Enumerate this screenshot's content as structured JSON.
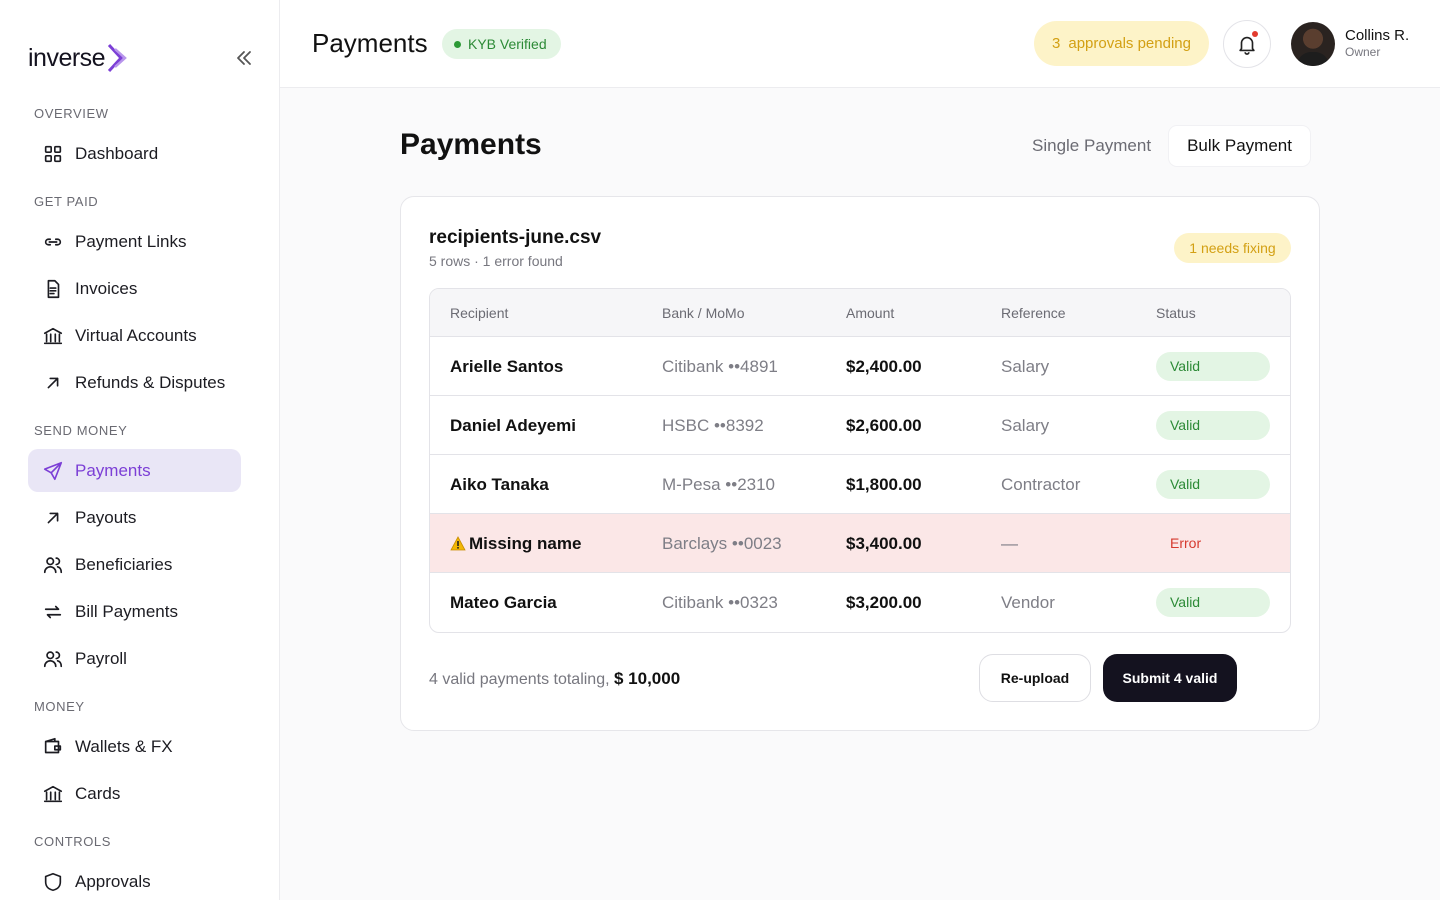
{
  "brand": {
    "logo_text": "inverse",
    "accent": "#7c3fd6"
  },
  "sidebar": {
    "sections": [
      {
        "title": "OVERVIEW",
        "items": [
          {
            "label": "Dashboard",
            "icon": "grid-icon"
          }
        ]
      },
      {
        "title": "GET PAID",
        "items": [
          {
            "label": "Payment Links",
            "icon": "link-icon"
          },
          {
            "label": "Invoices",
            "icon": "document-icon"
          },
          {
            "label": "Virtual Accounts",
            "icon": "bank-icon"
          },
          {
            "label": "Refunds & Disputes",
            "icon": "arrow-up-right-icon"
          }
        ]
      },
      {
        "title": "SEND MONEY",
        "items": [
          {
            "label": "Payments",
            "icon": "send-icon",
            "active": true
          },
          {
            "label": "Payouts",
            "icon": "arrow-up-right-icon"
          },
          {
            "label": "Beneficiaries",
            "icon": "users-icon"
          },
          {
            "label": "Bill Payments",
            "icon": "transfer-icon"
          },
          {
            "label": "Payroll",
            "icon": "users-icon"
          }
        ]
      },
      {
        "title": "MONEY",
        "items": [
          {
            "label": "Wallets & FX",
            "icon": "wallet-icon"
          },
          {
            "label": "Cards",
            "icon": "bank-icon"
          }
        ]
      },
      {
        "title": "CONTROLS",
        "items": [
          {
            "label": "Approvals",
            "icon": "shield-icon"
          }
        ]
      }
    ]
  },
  "header": {
    "title": "Payments",
    "kyb_label": "KYB Verified",
    "approvals_count": "3",
    "approvals_label": "approvals pending",
    "user_name": "Collins R.",
    "user_role": "Owner"
  },
  "main": {
    "title": "Payments",
    "tabs": [
      {
        "label": "Single Payment",
        "active": false
      },
      {
        "label": "Bulk Payment",
        "active": true
      }
    ]
  },
  "upload": {
    "file_name": "recipients-june.csv",
    "meta": "5 rows · 1 error found",
    "fix_badge": "1 needs fixing",
    "columns": [
      "Recipient",
      "Bank / MoMo",
      "Amount",
      "Reference",
      "Status"
    ],
    "rows": [
      {
        "recipient": "Arielle Santos",
        "bank": "Citibank ••4891",
        "amount": "$2,400.00",
        "reference": "Salary",
        "status": "Valid",
        "error": false
      },
      {
        "recipient": "Daniel Adeyemi",
        "bank": "HSBC ••8392",
        "amount": "$2,600.00",
        "reference": "Salary",
        "status": "Valid",
        "error": false
      },
      {
        "recipient": "Aiko Tanaka",
        "bank": "M-Pesa ••2310",
        "amount": "$1,800.00",
        "reference": "Contractor",
        "status": "Valid",
        "error": false
      },
      {
        "recipient": "Missing name",
        "bank": "Barclays ••0023",
        "amount": "$3,400.00",
        "reference": "—",
        "status": "Error",
        "error": true
      },
      {
        "recipient": "Mateo Garcia",
        "bank": "Citibank ••0323",
        "amount": "$3,200.00",
        "reference": "Vendor",
        "status": "Valid",
        "error": false
      }
    ],
    "totals_label": "4 valid payments totaling,",
    "totals_value": "$ 10,000",
    "reupload_label": "Re-upload",
    "submit_label": "Submit 4 valid"
  }
}
